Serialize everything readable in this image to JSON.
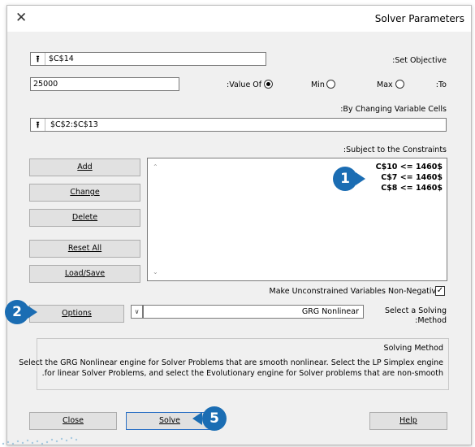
{
  "window": {
    "title": "Solver Parameters",
    "close_glyph": "✕"
  },
  "objective": {
    "label": ":Set Objective",
    "value": "$C$14",
    "ref_glyph": "⭱"
  },
  "to": {
    "label": ":To",
    "value_field": "25000",
    "value_of_label": ":Value Of",
    "min_label": "Min",
    "max_label": "Max",
    "selected": "value_of"
  },
  "changing_cells": {
    "label": ":By Changing Variable Cells",
    "value": "$C$2:$C$13",
    "ref_glyph": "⭱"
  },
  "constraints": {
    "label": ":Subject to the Constraints",
    "items": [
      "C$10 <= 1460$",
      "C$7 <= 1460$",
      "C$8 <= 1460$"
    ]
  },
  "buttons": {
    "add": "Add",
    "change": "Change",
    "delete": "Delete",
    "reset_all": "Reset All",
    "load_save": "Load/Save",
    "options": "Options",
    "close": "Close",
    "solve": "Solve",
    "help": "Help"
  },
  "nonneg": {
    "label": "Make Unconstrained Variables Non-Negative",
    "checked": true,
    "check_glyph": "✓"
  },
  "method": {
    "label_line1": "Select a Solving",
    "label_line2": ":Method",
    "selected": "GRG Nonlinear"
  },
  "solving_method": {
    "title": "Solving Method",
    "line1": "Select the GRG Nonlinear engine for Solver Problems that are smooth nonlinear. Select the LP Simplex engine",
    "line2": ".for linear Solver Problems, and select the Evolutionary engine for Solver problems that are non-smooth"
  },
  "callouts": {
    "one": "1",
    "two": "2",
    "five": "5"
  },
  "colors": {
    "badge": "#1b6db3",
    "dialog_bg": "#f0f0f0",
    "button_bg": "#e1e1e1"
  }
}
